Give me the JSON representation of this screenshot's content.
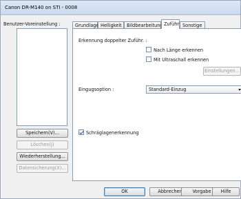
{
  "window": {
    "title": "Canon DR-M140 on STI - 0008"
  },
  "left": {
    "preset_label": "Benutzer-Voreinstellung :",
    "buttons": {
      "save": "Speichern(V)...",
      "delete": "Löschen(J)",
      "restore": "Wiederherstellung...",
      "backup": "Datensicherung(X)..."
    }
  },
  "tabs": [
    "Grundlage",
    "Helligkeit",
    "Bildbearbeitung",
    "Zuführ",
    "Sonstige"
  ],
  "feed": {
    "double_feed_label": "Erkennung doppelter Zuführ. :",
    "by_length": {
      "label": "Nach Länge erkennen",
      "checked": false
    },
    "by_ultrasonic": {
      "label": "Mit Ultraschall erkennen",
      "checked": false
    },
    "settings_button": "Einstellungen...",
    "feed_option_label": "Eingugsoption :",
    "feed_option_value": "Standard-Einzug",
    "skew": {
      "label": "Schräglagenerkennung",
      "checked": true
    }
  },
  "footer": {
    "ok": "OK",
    "cancel": "Abbrechen",
    "defaults": "Vorgabe",
    "help": "Hilfe"
  }
}
